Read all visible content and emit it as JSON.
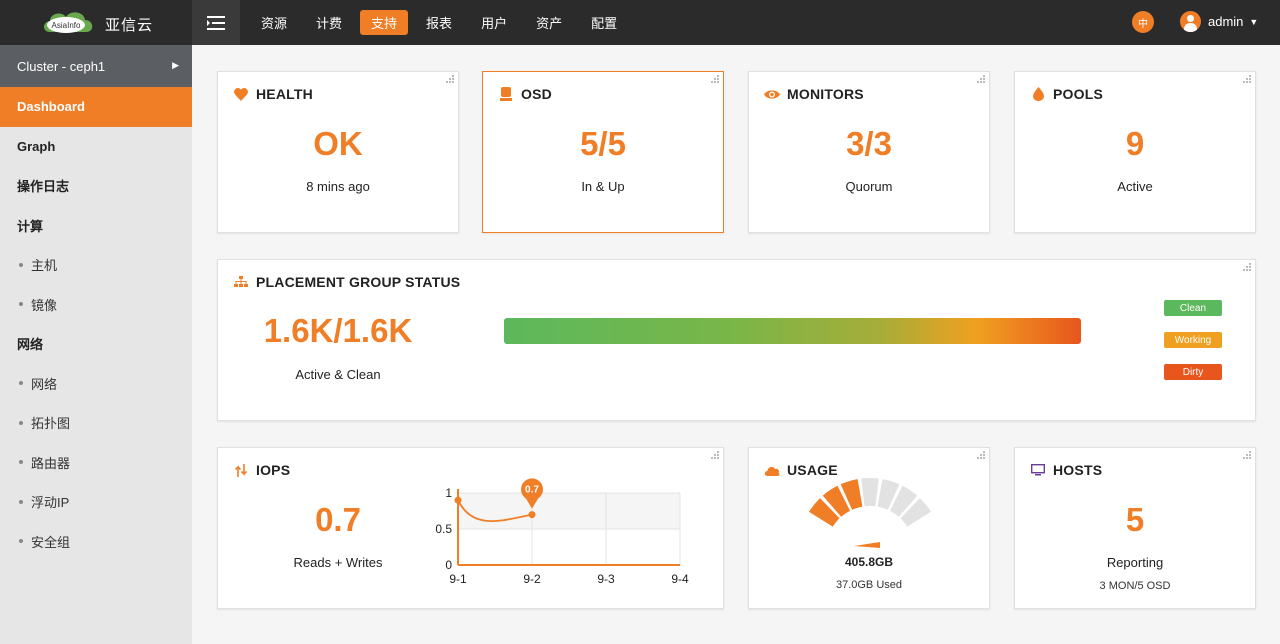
{
  "topbar": {
    "logo_brand": "AsiaInfo",
    "logo_text": "亚信云",
    "nav": [
      {
        "label": "资源",
        "active": false
      },
      {
        "label": "计费",
        "active": false
      },
      {
        "label": "支持",
        "active": true
      },
      {
        "label": "报表",
        "active": false
      },
      {
        "label": "用户",
        "active": false
      },
      {
        "label": "资产",
        "active": false
      },
      {
        "label": "配置",
        "active": false
      }
    ],
    "lang": "中",
    "user": "admin"
  },
  "sidebar": {
    "cluster": "Cluster - ceph1",
    "items": [
      {
        "label": "Dashboard",
        "type": "item",
        "active": true
      },
      {
        "label": "Graph",
        "type": "item"
      },
      {
        "label": "操作日志",
        "type": "item"
      },
      {
        "label": "计算",
        "type": "item"
      },
      {
        "label": "主机",
        "type": "sub"
      },
      {
        "label": "镜像",
        "type": "sub"
      },
      {
        "label": "网络",
        "type": "item"
      },
      {
        "label": "网络",
        "type": "sub"
      },
      {
        "label": "拓扑图",
        "type": "sub"
      },
      {
        "label": "路由器",
        "type": "sub"
      },
      {
        "label": "浮动IP",
        "type": "sub"
      },
      {
        "label": "安全组",
        "type": "sub"
      }
    ]
  },
  "cards": {
    "health": {
      "title": "HEALTH",
      "value": "OK",
      "sub": "8 mins ago"
    },
    "osd": {
      "title": "OSD",
      "value": "5/5",
      "sub": "In & Up"
    },
    "monitors": {
      "title": "MONITORS",
      "value": "3/3",
      "sub": "Quorum"
    },
    "pools": {
      "title": "POOLS",
      "value": "9",
      "sub": "Active"
    },
    "pg": {
      "title": "PLACEMENT GROUP STATUS",
      "value": "1.6K/1.6K",
      "sub": "Active & Clean",
      "legend": [
        "Clean",
        "Working",
        "Dirty"
      ]
    },
    "iops": {
      "title": "IOPS",
      "value": "0.7",
      "sub": "Reads + Writes"
    },
    "usage": {
      "title": "USAGE",
      "value": "405.8GB",
      "sub": "37.0GB Used",
      "gauge_fraction": 0.4
    },
    "hosts": {
      "title": "HOSTS",
      "value": "5",
      "sub": "Reporting",
      "sub2": "3 MON/5 OSD"
    }
  },
  "colors": {
    "accent": "#f07e26",
    "clean": "#5cb85c",
    "working": "#f0a020",
    "dirty": "#e8561e"
  },
  "chart_data": {
    "type": "line",
    "x": [
      "9-1",
      "9-2",
      "9-3",
      "9-4"
    ],
    "series": [
      {
        "values": [
          0.9,
          0.7,
          null,
          null
        ]
      }
    ],
    "ylim": [
      0,
      1
    ],
    "yticks": [
      "0",
      "0.5",
      "1"
    ],
    "annotation": "0.7"
  }
}
